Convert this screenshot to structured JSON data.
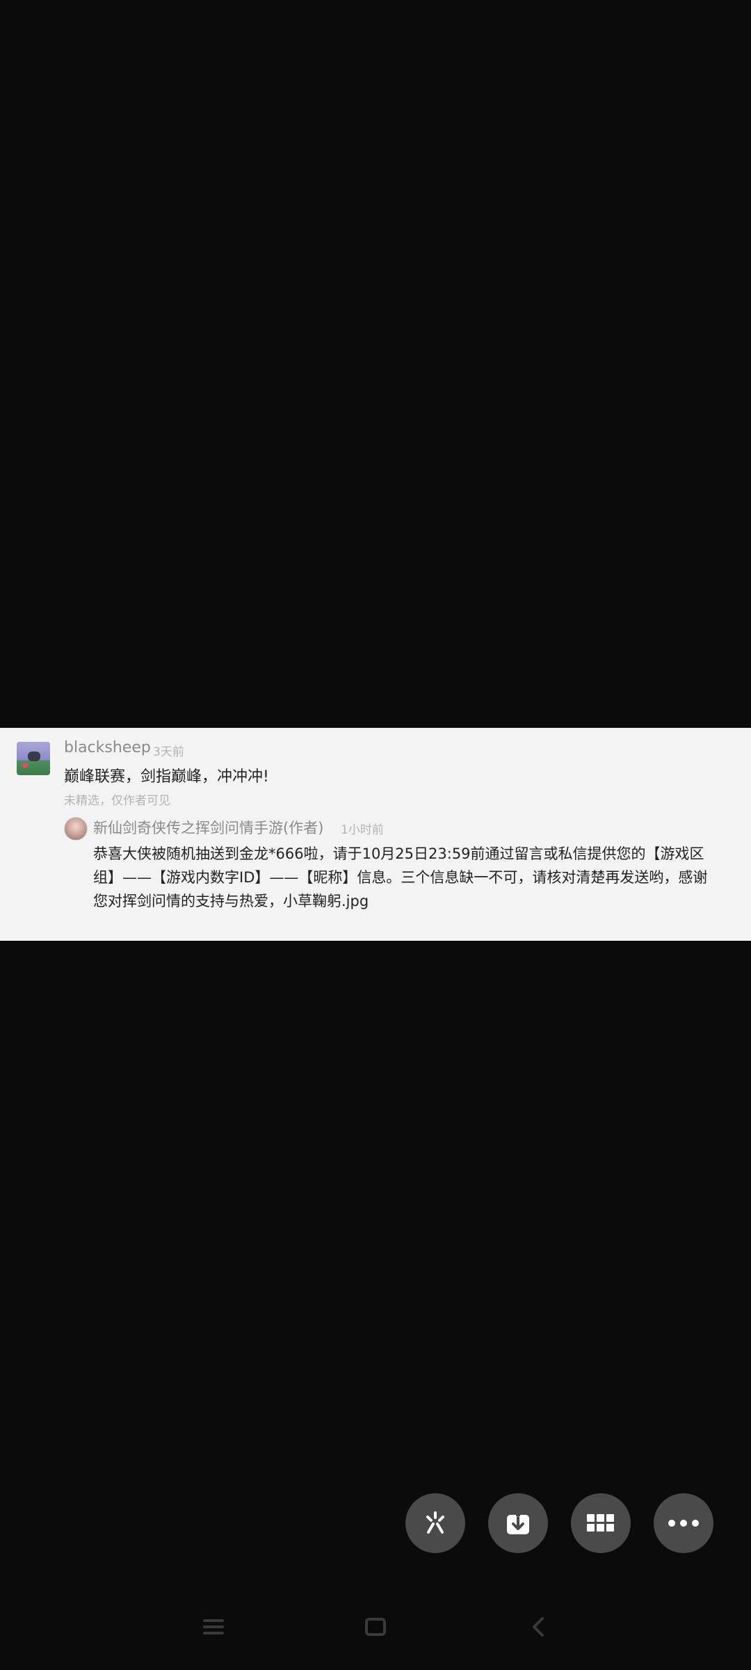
{
  "comment": {
    "username": "blacksheep",
    "time": "3天前",
    "text": "巅峰联赛，剑指巅峰，冲冲冲!",
    "status_note": "未精选，仅作者可见",
    "avatar_icon": "user-avatar",
    "reply": {
      "author": "新仙剑奇侠传之挥剑问情手游(作者)",
      "time": "1小时前",
      "avatar_icon": "author-avatar",
      "text": "恭喜大侠被随机抽送到金龙*666啦，请于10月25日23:59前通过留言或私信提供您的【游戏区组】——【游戏内数字ID】——【昵称】信息。三个信息缺一不可，请核对清楚再发送哟，感谢您对挥剑问情的支持与热爱，小草鞠躬.jpg"
    }
  },
  "action_buttons": [
    {
      "icon": "sparkle-icon"
    },
    {
      "icon": "download-icon"
    },
    {
      "icon": "grid-icon"
    },
    {
      "icon": "more-icon"
    }
  ],
  "system_nav": {
    "menu_icon": "menu-icon",
    "home_icon": "home-icon",
    "back_icon": "back-icon"
  },
  "colors": {
    "background": "#0b0b0b",
    "card": "#f3f3f3",
    "fab": "#4a4a4a"
  }
}
